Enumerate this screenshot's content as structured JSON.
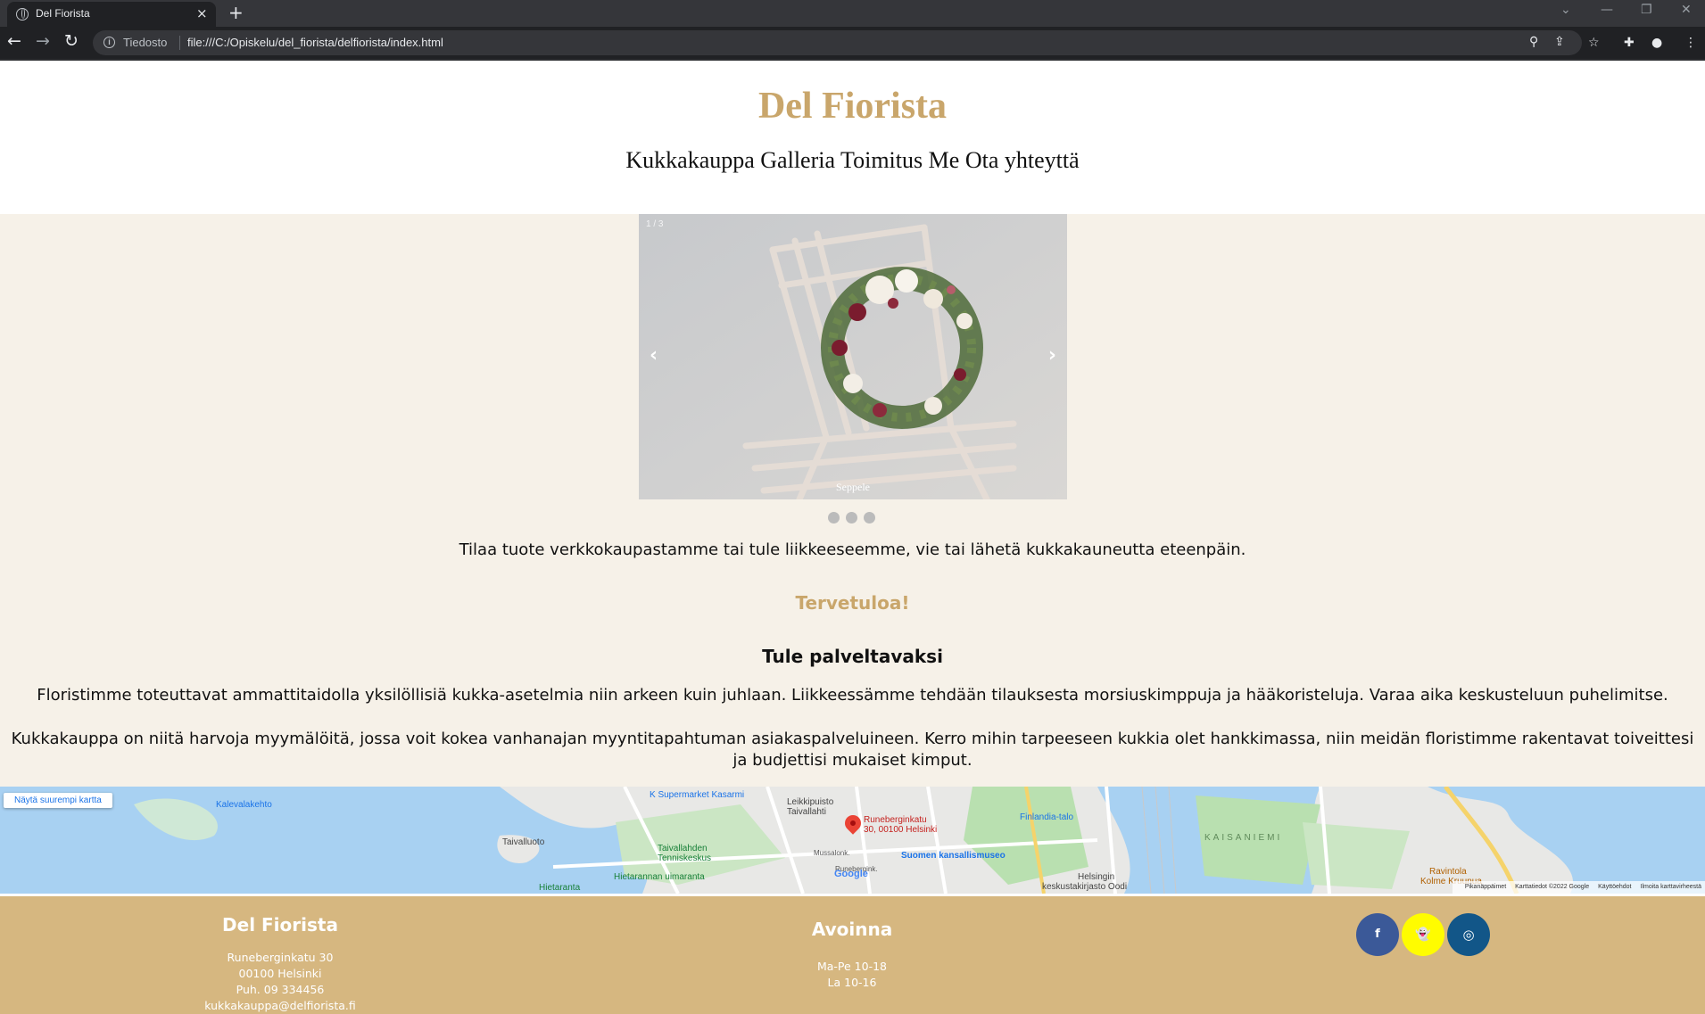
{
  "browser": {
    "tab_title": "Del Fiorista",
    "tab_close": "×",
    "new_tab": "+",
    "omnibox_label": "Tiedosto",
    "url": "file:///C:/Opiskelu/del_fiorista/delfiorista/index.html",
    "icons": [
      "back-arrow-icon",
      "forward-arrow-icon",
      "reload-icon",
      "info-icon",
      "zoom-icon",
      "share-icon",
      "star-icon",
      "extensions-icon",
      "profile-icon",
      "menu-icon"
    ]
  },
  "header": {
    "title": "Del Fiorista",
    "nav": [
      "Kukkakauppa",
      "Galleria",
      "Toimitus",
      "Me",
      "Ota yhteyttä"
    ]
  },
  "slideshow": {
    "counter": "1 / 3",
    "caption": "Seppele",
    "prev": "‹",
    "next": "›",
    "dot_count": 3
  },
  "main": {
    "intro": "Tilaa tuote verkkokaupastamme tai tule liikkeeseemme, vie tai lähetä kukkakauneutta eteenpäin.",
    "welcome": "Tervetuloa!",
    "subheading": "Tule palveltavaksi",
    "paragraph1": "Floristimme toteuttavat ammattitaidolla yksilöllisiä kukka-asetelmia niin arkeen kuin juhlaan. Liikkeessämme tehdään tilauksesta morsiuskimppuja ja hääkoristeluja. Varaa aika keskusteluun puhelimitse.",
    "paragraph2": "Kukkakauppa on niitä harvoja myymälöitä, jossa voit kokea vanhanajan myyntitapahtuman asiakaspalveluineen. Kerro mihin tarpeeseen kukkia olet hankkimassa, niin meidän floristimme rakentavat toiveittesi ja budjettisi mukaiset kimput."
  },
  "map": {
    "larger_map": "Näytä suurempi kartta",
    "pin_label_1": "Runeberginkatu",
    "pin_label_2": "30, 00100 Helsinki",
    "places": {
      "kalevalakehto": "Kalevalakehto",
      "supermarket": "K Supermarket Kasarmi",
      "leikkipuisto_1": "Leikkipuisto",
      "leikkipuisto_2": "Taivallahti",
      "taivalluoto": "Taivalluoto",
      "tennis_1": "Taivallahden",
      "tennis_2": "Tenniskeskus",
      "hietarannan": "Hietarannan uimaranta",
      "hietaranta": "Hietaranta",
      "finlandia": "Finlandia-talo",
      "kansallismuseo": "Suomen kansallismuseo",
      "kaisaniemi": "KAISANIEMI",
      "helsingin_1": "Helsingin",
      "helsingin_2": "keskustakirjasto Oodi",
      "ravintola_1": "Ravintola",
      "ravintola_2": "Kolme Kruunua",
      "mussalo": "Mussalonk.",
      "runeberg_street": "Runebergink."
    },
    "google": "Google",
    "footer": [
      "Pikanäppäimet",
      "Karttatiedot ©2022 Google",
      "Käyttöehdot",
      "Ilmoita karttavirheestä"
    ]
  },
  "footer": {
    "name": "Del Fiorista",
    "address": [
      "Runeberginkatu 30",
      "00100 Helsinki",
      "Puh. 09 334456",
      "kukkakauppa@delfiorista.fi"
    ],
    "open_title": "Avoinna",
    "hours": [
      "Ma-Pe 10-18",
      "La 10-16"
    ],
    "social": {
      "facebook": "f",
      "snapchat": "👻",
      "instagram": "◎"
    }
  },
  "colors": {
    "accent_gold": "#c9a66b",
    "beige_bg": "#f6f1e8",
    "footer_bg": "#d6b780",
    "facebook": "#3b5998",
    "snapchat": "#fffc00",
    "instagram": "#125688"
  }
}
